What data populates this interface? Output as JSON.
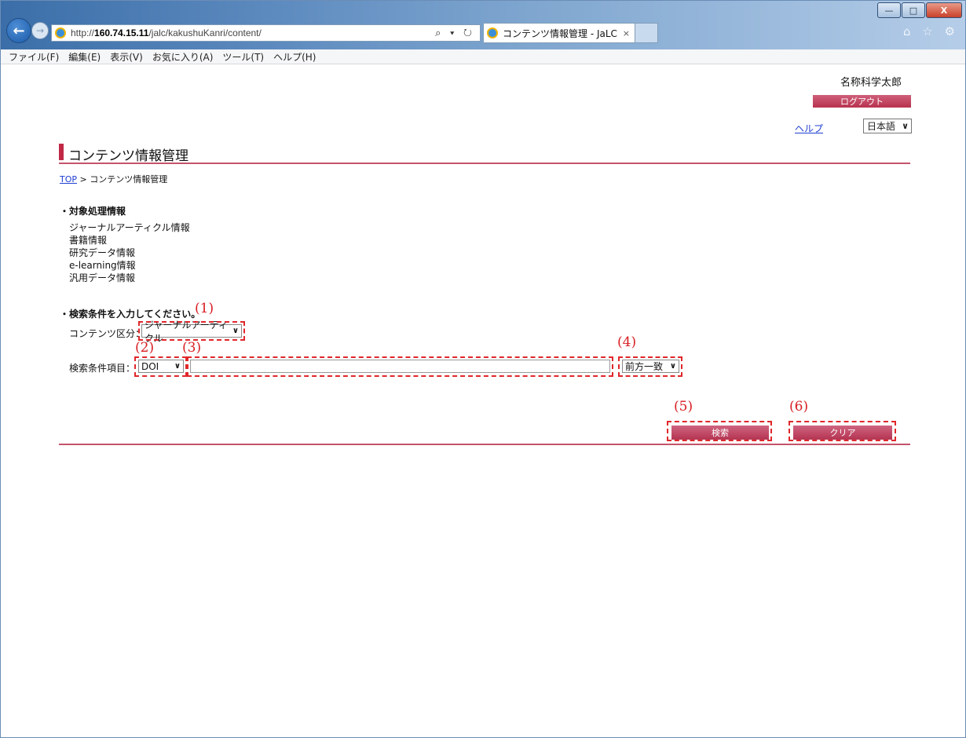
{
  "browser": {
    "url_prefix": "http://",
    "url_host": "160.74.15.11",
    "url_path": "/jalc/kakushuKanri/content/",
    "url_controls": "⌕ ▾ ↻",
    "tab_title": "コンテンツ情報管理 - JaLC",
    "tab_close": "×",
    "toolbar_icons": "⌂ ☆ ⚙",
    "window_buttons": {
      "minimize": "—",
      "maximize": "□",
      "close": "X"
    }
  },
  "menu": [
    "ファイル(F)",
    "編集(E)",
    "表示(V)",
    "お気に入り(A)",
    "ツール(T)",
    "ヘルプ(H)"
  ],
  "header": {
    "user_name": "名称科学太郎",
    "logout_label": "ログアウト",
    "help_link": "ヘルプ",
    "language": "日本語"
  },
  "page": {
    "title": "コンテンツ情報管理",
    "breadcrumb_top": "TOP",
    "breadcrumb_sep": " > ",
    "breadcrumb_current": "コンテンツ情報管理"
  },
  "target_info": {
    "heading": "・対象処理情報",
    "items": [
      "ジャーナルアーティクル情報",
      "書籍情報",
      "研究データ情報",
      "e-learning情報",
      "汎用データ情報"
    ]
  },
  "search": {
    "heading": "・検索条件を入力してください。",
    "content_type_label": "コンテンツ区分：",
    "content_type_value": "ジャーナルアーティクル",
    "condition_label": "検索条件項目：",
    "condition_field_value": "DOI",
    "condition_text_value": "",
    "match_mode_value": "前方一致",
    "search_button": "検索",
    "clear_button": "クリア"
  },
  "annotations": [
    "(1)",
    "(2)",
    "(3)",
    "(4)",
    "(5)",
    "(6)"
  ],
  "colors": {
    "accent": "#c12846",
    "annotation": "#e0272b",
    "link": "#1f3fd1"
  }
}
